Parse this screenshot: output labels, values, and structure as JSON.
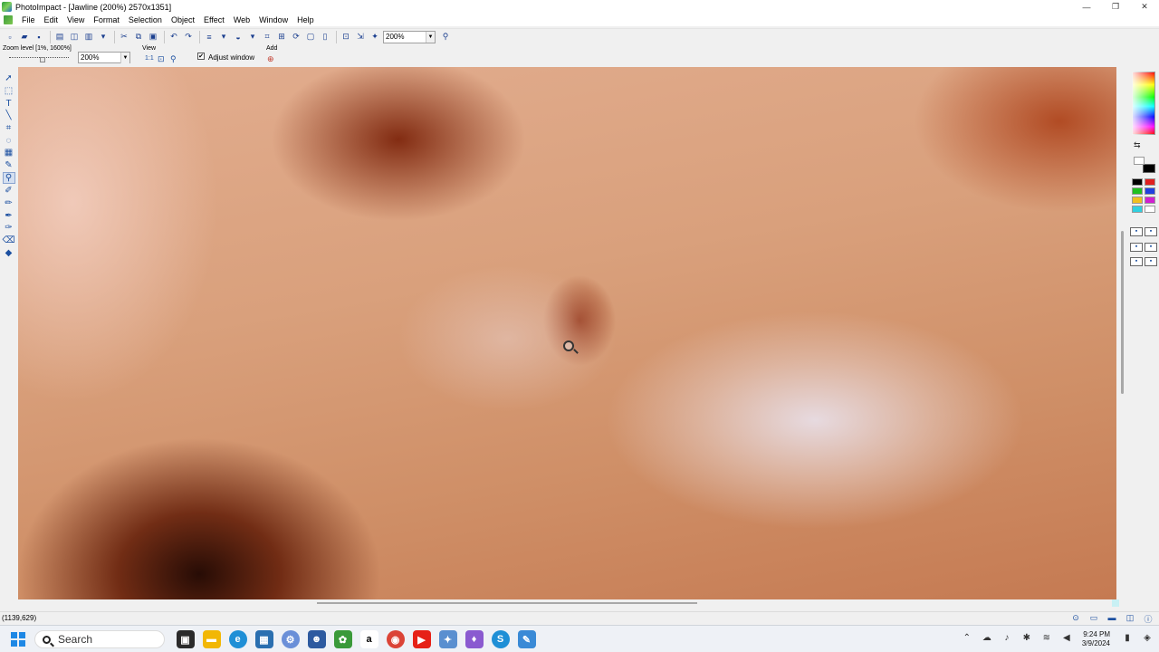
{
  "window": {
    "title": "PhotoImpact - [Jawline (200%) 2570x1351]",
    "controls": [
      "—",
      "❐",
      "✕"
    ]
  },
  "menu": [
    "File",
    "Edit",
    "View",
    "Format",
    "Selection",
    "Object",
    "Effect",
    "Web",
    "Window",
    "Help"
  ],
  "toolbar": {
    "zoom_value": "200%"
  },
  "attributes": {
    "zoom_level_label": "Zoom level [1%, 1600%]",
    "zoom_combo": "200%",
    "view_label": "View",
    "view_ratio": "1:1",
    "adjust_window_label": "Adjust window",
    "adjust_window_checked": true,
    "add_label": "Add"
  },
  "status": {
    "coords": "(1139,629)"
  },
  "taskbar": {
    "search_label": "Search",
    "time": "9:24 PM",
    "date": "3/9/2024"
  },
  "colors": {
    "accent": "#1e88e5",
    "panel_bg": "#f0f0f0"
  }
}
